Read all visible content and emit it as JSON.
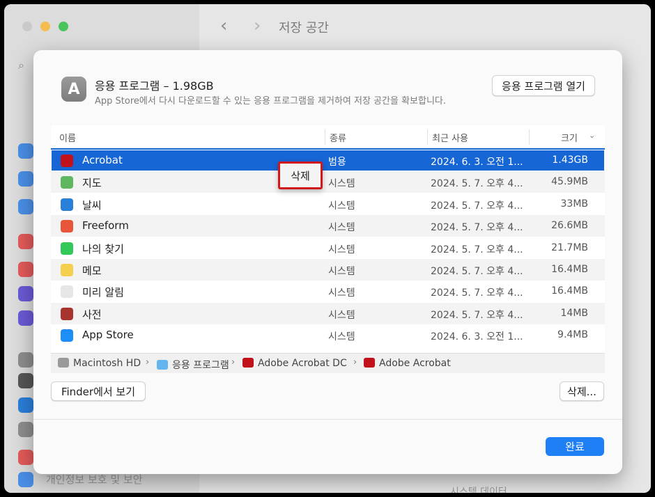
{
  "window": {
    "title": "저장 공간",
    "background_bottom_text": "개인정보 보호 및 보안",
    "background_bottom_text2": "시스템 데이터"
  },
  "dialog": {
    "title": "응용 프로그램 – 1.98GB",
    "subtitle": "App Store에서 다시 다운로드할 수 있는 응용 프로그램을 제거하여 저장 공간을 확보합니다.",
    "open_button": "응용 프로그램 열기",
    "finder_button": "Finder에서 보기",
    "delete_button": "삭제...",
    "done_button": "완료",
    "icon": "app-store-icon"
  },
  "table": {
    "columns": [
      "이름",
      "종류",
      "최근 사용",
      "크기"
    ],
    "rows": [
      {
        "name": "Acrobat",
        "kind": "범용",
        "date": "2024. 6. 3. 오전 1...",
        "size": "1.43GB",
        "icon": "acrobat-icon",
        "color": "#c1121c"
      },
      {
        "name": "지도",
        "kind": "시스템",
        "date": "2024. 5. 7. 오후 4...",
        "size": "45.9MB",
        "icon": "maps-icon",
        "color": "#5fb760"
      },
      {
        "name": "날씨",
        "kind": "시스템",
        "date": "2024. 5. 7. 오후 4...",
        "size": "33MB",
        "icon": "weather-icon",
        "color": "#2a7fd9"
      },
      {
        "name": "Freeform",
        "kind": "시스템",
        "date": "2024. 5. 7. 오후 4...",
        "size": "26.6MB",
        "icon": "freeform-icon",
        "color": "#e8553b"
      },
      {
        "name": "나의 찾기",
        "kind": "시스템",
        "date": "2024. 5. 7. 오후 4...",
        "size": "21.7MB",
        "icon": "find-my-icon",
        "color": "#34c759"
      },
      {
        "name": "메모",
        "kind": "시스템",
        "date": "2024. 5. 7. 오후 4...",
        "size": "16.4MB",
        "icon": "notes-icon",
        "color": "#f5d04c"
      },
      {
        "name": "미리 알림",
        "kind": "시스템",
        "date": "2024. 5. 7. 오후 4...",
        "size": "16.4MB",
        "icon": "reminders-icon",
        "color": "#e6e6e6"
      },
      {
        "name": "사전",
        "kind": "시스템",
        "date": "2024. 5. 7. 오후 4...",
        "size": "14MB",
        "icon": "dictionary-icon",
        "color": "#a8352d"
      },
      {
        "name": "App Store",
        "kind": "시스템",
        "date": "2024. 6. 3. 오전 1...",
        "size": "9.4MB",
        "icon": "app-store-icon",
        "color": "#1c8ef5"
      }
    ]
  },
  "context_menu": {
    "delete": "삭제"
  },
  "pathbar": {
    "items": [
      "Macintosh HD",
      "응용 프로그램",
      "Adobe Acrobat DC",
      "Adobe Acrobat"
    ],
    "separator": "›"
  },
  "colors": {
    "selection": "#1766d6",
    "accent": "#1f80f5",
    "highlight_box": "#d01818"
  }
}
